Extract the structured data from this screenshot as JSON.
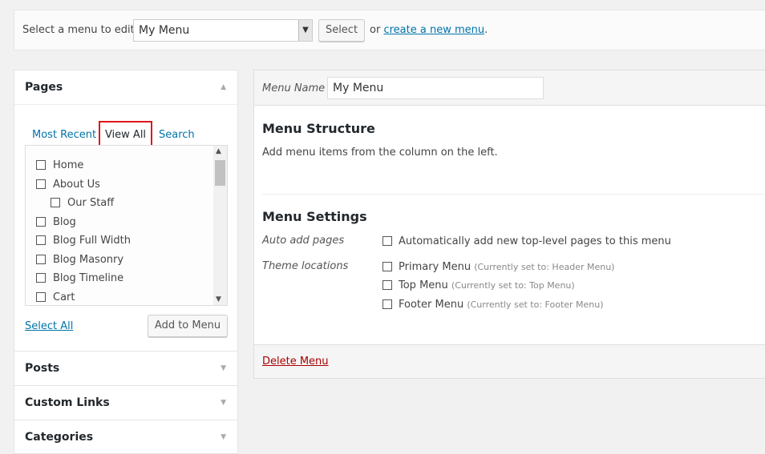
{
  "top": {
    "label": "Select a menu to edit:",
    "menu_select_value": "My Menu",
    "select_button": "Select",
    "or_text": "or",
    "create_link": "create a new menu",
    "period": "."
  },
  "left": {
    "pages_title": "Pages",
    "tabs": {
      "most_recent": "Most Recent",
      "view_all": "View All",
      "search": "Search"
    },
    "pages": [
      {
        "label": "Home"
      },
      {
        "label": "About Us"
      },
      {
        "label": "Our Staff"
      },
      {
        "label": "Blog"
      },
      {
        "label": "Blog Full Width"
      },
      {
        "label": "Blog Masonry"
      },
      {
        "label": "Blog Timeline"
      },
      {
        "label": "Cart"
      }
    ],
    "select_all": "Select All",
    "add_to_menu": "Add to Menu",
    "posts_title": "Posts",
    "custom_links_title": "Custom Links",
    "categories_title": "Categories"
  },
  "right": {
    "menu_name_label": "Menu Name",
    "menu_name_value": "My Menu",
    "structure_title": "Menu Structure",
    "structure_hint": "Add menu items from the column on the left.",
    "settings_title": "Menu Settings",
    "auto_add_label": "Auto add pages",
    "auto_add_option": "Automatically add new top-level pages to this menu",
    "theme_locations_label": "Theme locations",
    "locations": [
      {
        "name": "Primary Menu",
        "note": "(Currently set to: Header Menu)"
      },
      {
        "name": "Top Menu",
        "note": "(Currently set to: Top Menu)"
      },
      {
        "name": "Footer Menu",
        "note": "(Currently set to: Footer Menu)"
      }
    ],
    "delete_menu": "Delete Menu"
  },
  "colors": {
    "link": "#0073aa",
    "highlight": "#e0151c",
    "delete": "#aa0000"
  }
}
